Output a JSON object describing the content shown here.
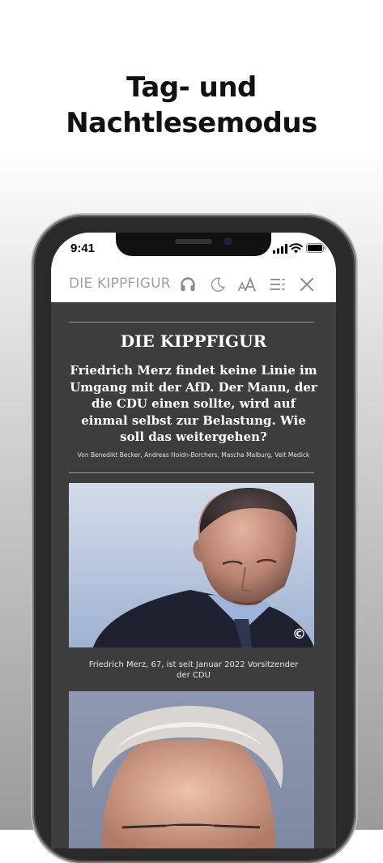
{
  "promo": {
    "headline_line1": "Tag- und",
    "headline_line2": "Nachtlesemodus"
  },
  "status_bar": {
    "time": "9:41"
  },
  "toolbar": {
    "title": "DIE KIPPFIGUR",
    "icons": [
      "headphones-icon",
      "moon-icon",
      "text-size-icon",
      "table-of-contents-icon",
      "close-icon"
    ]
  },
  "article": {
    "kicker": "DIE KIPPFIGUR",
    "dek": "Friedrich Merz findet keine Linie im Umgang mit der AfD. Der Mann, der die CDU einen sollte, wird auf einmal selbst zur Belastung. Wie soll das weitergehen?",
    "byline": "Von Benedikt Becker, Andreas Hoidn-Borchers, Mascha Malburg, Veit Medick",
    "photo1_copyright": "©",
    "photo1_caption": "Friedrich Merz, 67, ist seit Januar 2022 Vorsitzender der CDU"
  },
  "colors": {
    "night_background": "#3d3d3d",
    "toolbar_background": "#ffffff",
    "toolbar_text": "#a0a0a0"
  }
}
